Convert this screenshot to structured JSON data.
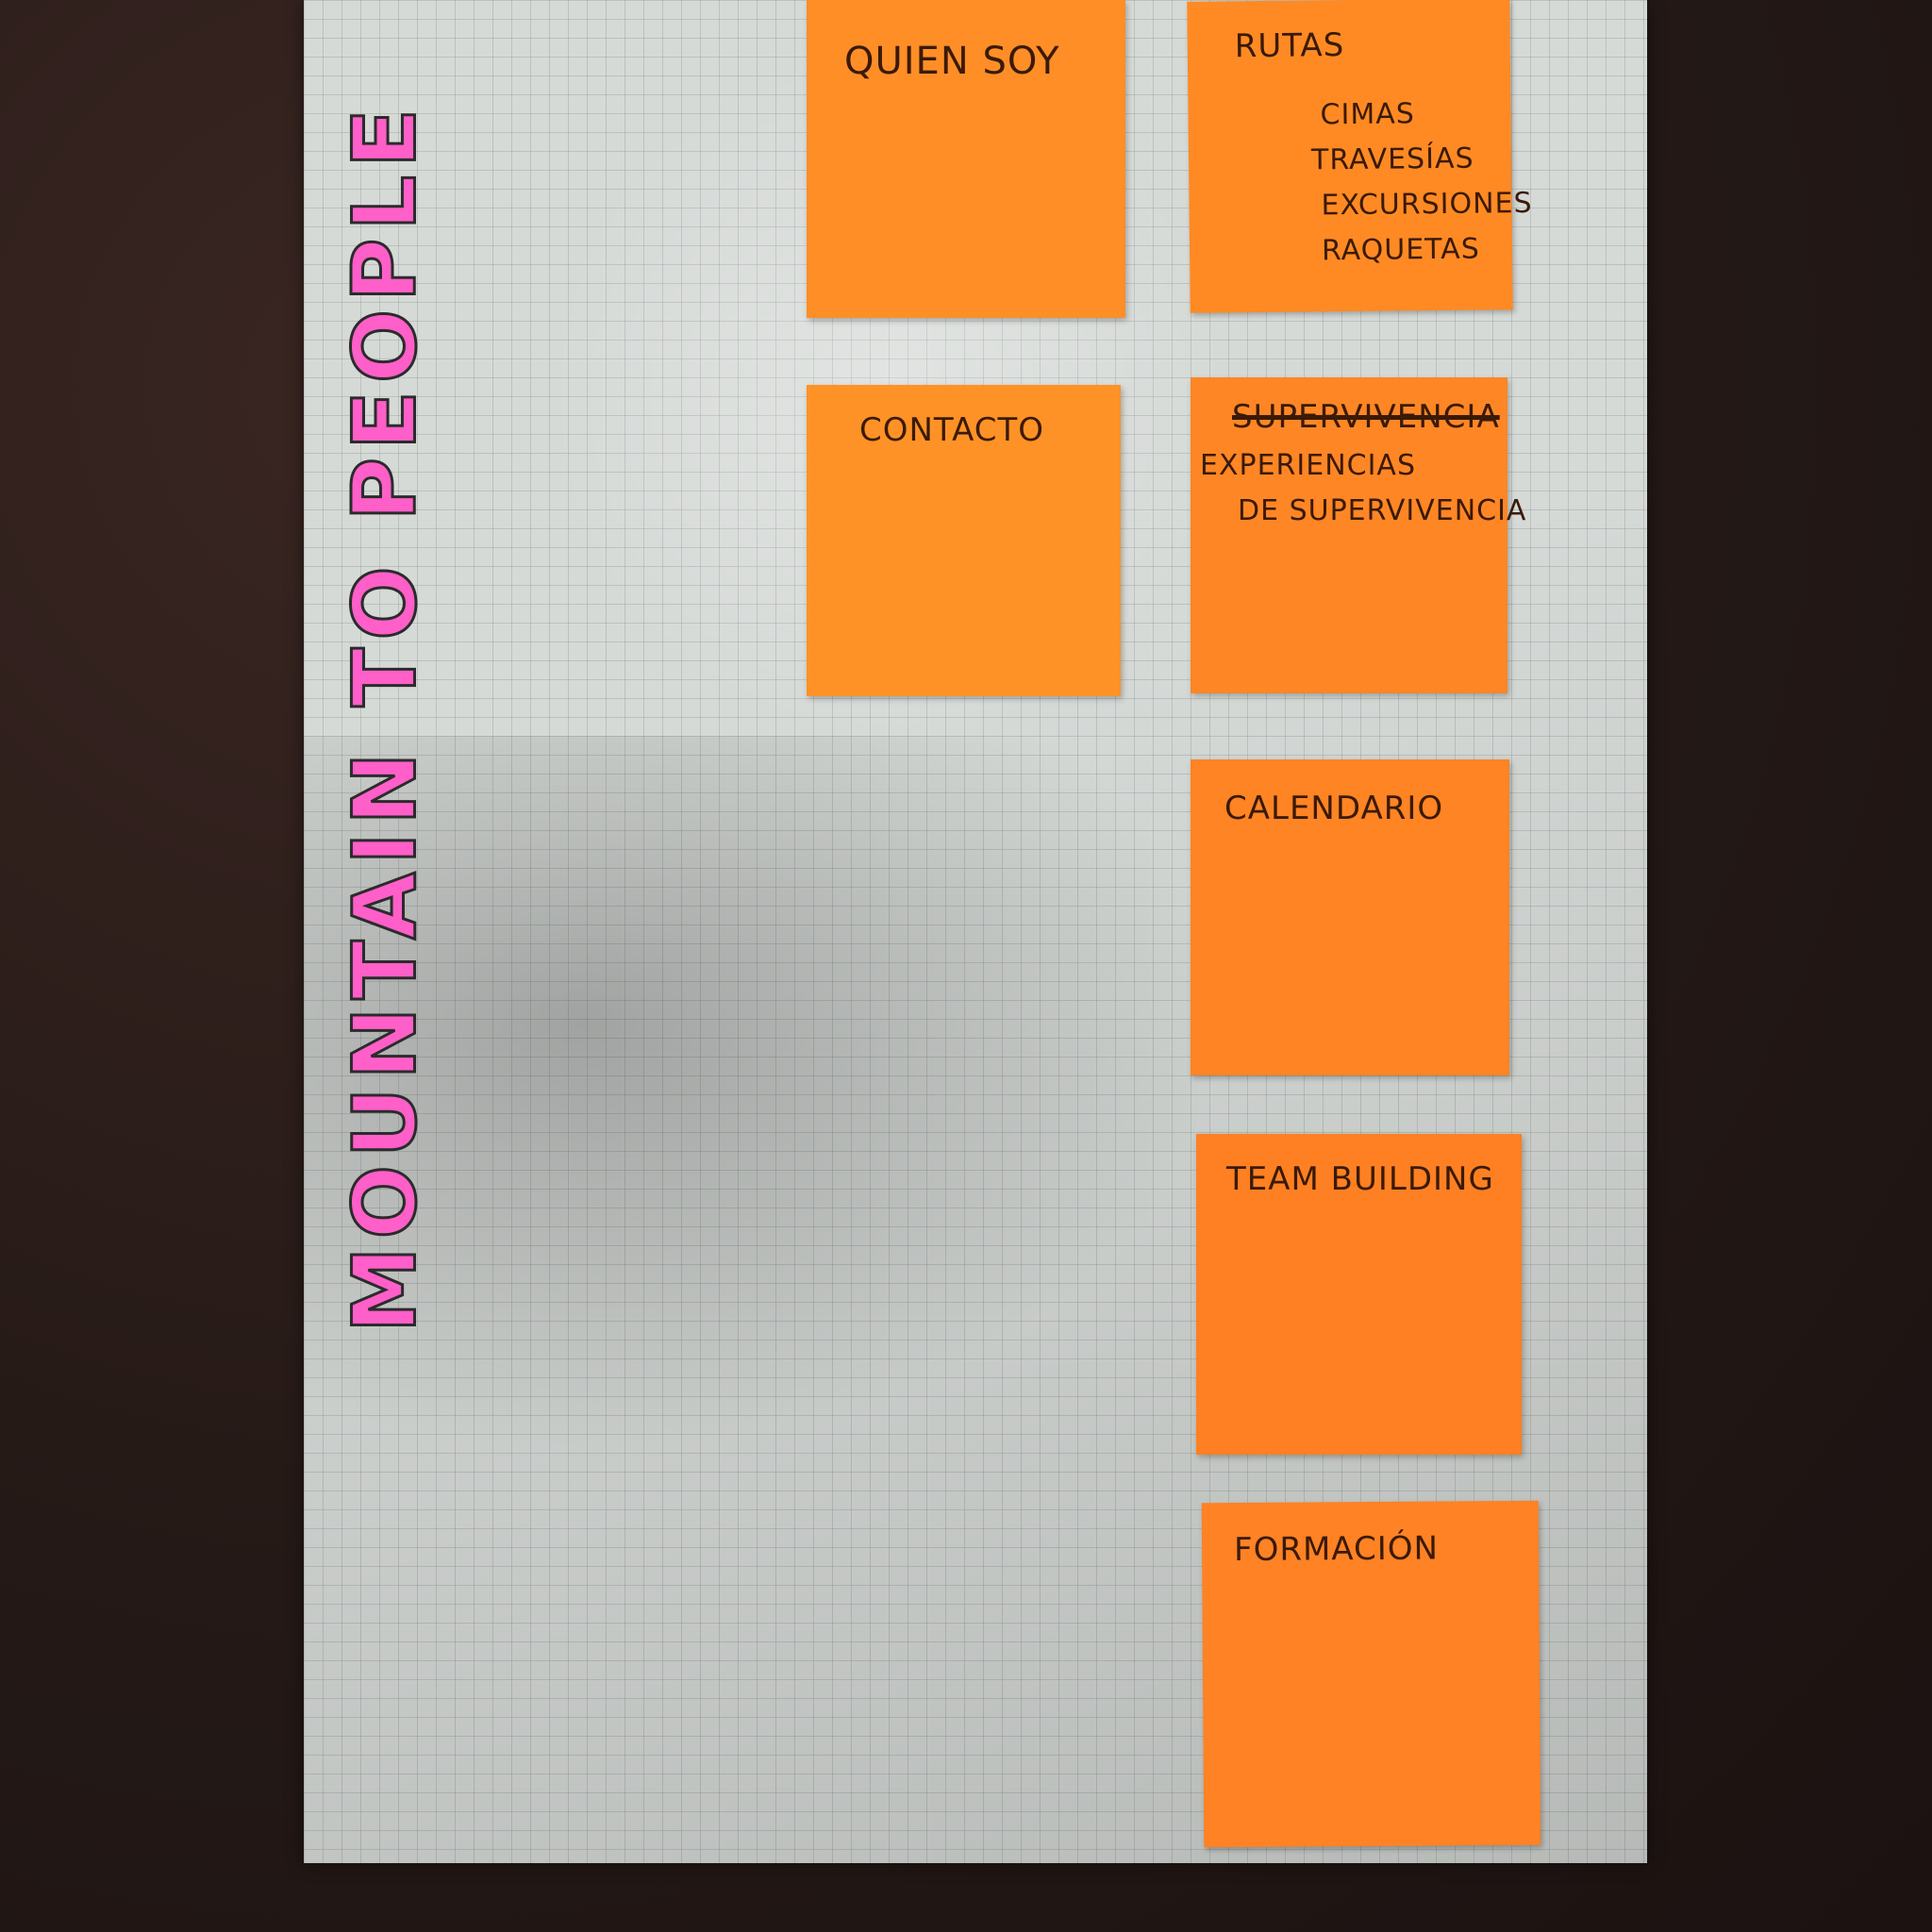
{
  "board": {
    "title": "MOUNTAIN TO PEOPLE",
    "title_color": "#ff5fc8",
    "note_color": "#ff8a25",
    "paper_color": "#d6dad7"
  },
  "notes": [
    {
      "title": "QUIEN SOY",
      "lines": []
    },
    {
      "title": "RUTAS",
      "lines": [
        "CIMAS",
        "TRAVESÍAS",
        "EXCURSIONES",
        "RAQUETAS"
      ]
    },
    {
      "title": "CONTACTO",
      "lines": []
    },
    {
      "title": "SUPERVIVENCIA",
      "struck": true,
      "lines": [
        "EXPERIENCIAS",
        "DE SUPERVIVENCIA"
      ]
    },
    {
      "title": "CALENDARIO",
      "lines": []
    },
    {
      "title": "TEAM BUILDING",
      "lines": []
    },
    {
      "title": "FORMACIÓN",
      "lines": []
    }
  ]
}
